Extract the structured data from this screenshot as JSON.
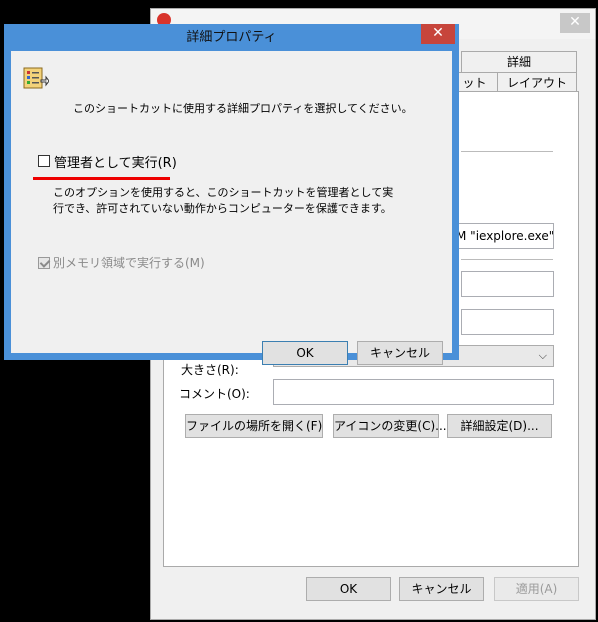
{
  "background_window": {
    "close_glyph": "✕",
    "tabs_row1": [
      "詳細"
    ],
    "tabs_row2": [
      "ット",
      "レイアウト"
    ],
    "target_value": "M \"iexplore.exe\"",
    "size_label": "大きさ(R):",
    "comment_label": "コメント(O):",
    "buttons": {
      "open_location": "ファイルの場所を開く(F)",
      "change_icon": "アイコンの変更(C)...",
      "advanced": "詳細設定(D)..."
    },
    "footer": {
      "ok": "OK",
      "cancel": "キャンセル",
      "apply": "適用(A)"
    }
  },
  "dialog": {
    "title": "詳細プロパティ",
    "close_glyph": "✕",
    "instruction": "このショートカットに使用する詳細プロパティを選択してください。",
    "run_as_admin": {
      "label": "管理者として実行(R)",
      "checked": false
    },
    "description": "このオプションを使用すると、このショートカットを管理者として実行でき、許可されていない動作からコンピューターを保護できます。",
    "separate_memory": {
      "label": "別メモリ領域で実行する(M)",
      "checked": true,
      "enabled": false
    },
    "ok": "OK",
    "cancel": "キャンセル",
    "accent_color": "#4a90d8",
    "highlight_color": "#e00000"
  }
}
